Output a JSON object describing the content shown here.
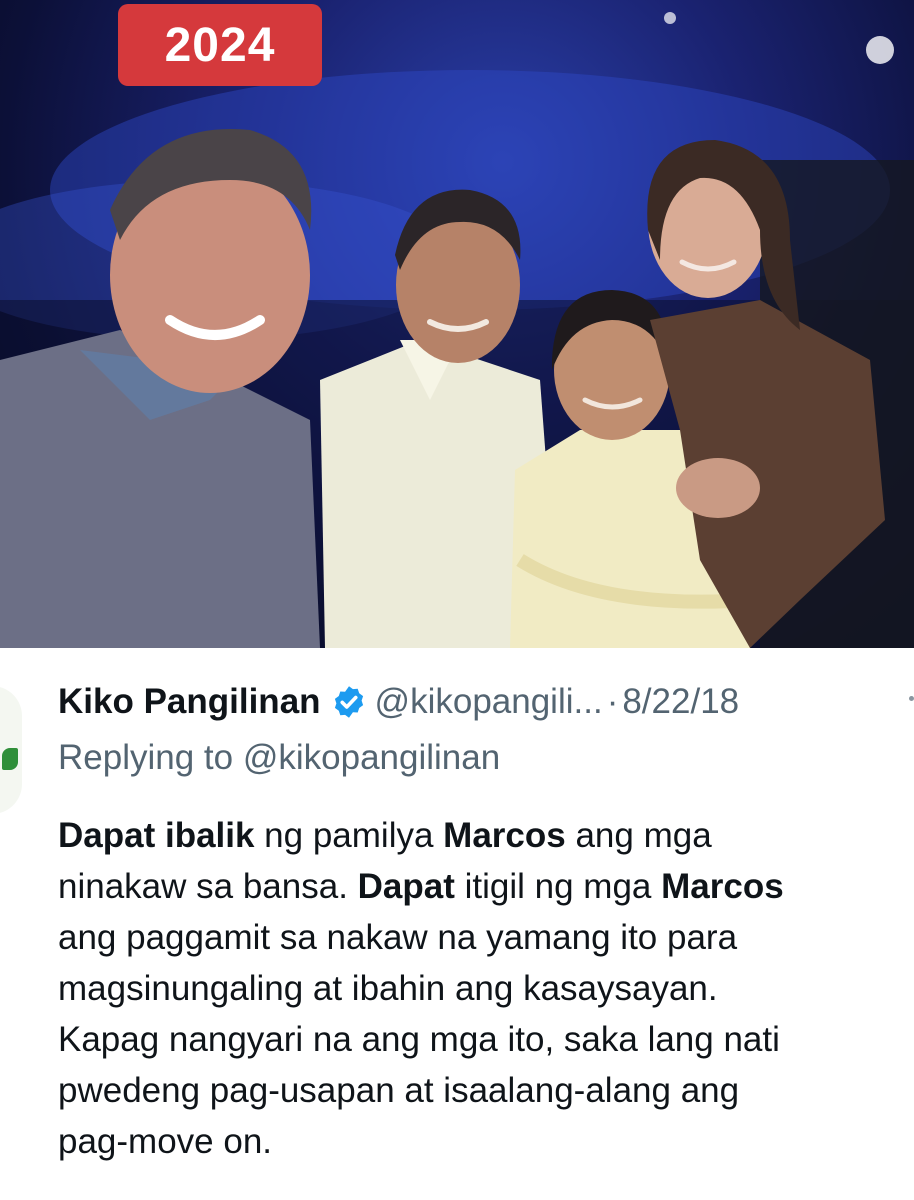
{
  "photo": {
    "year_badge": "2024",
    "accent": "#d5393c"
  },
  "tweet": {
    "author": {
      "display_name": "Kiko Pangilinan",
      "verified_icon": "verified-badge-icon",
      "handle": "@kikopangili...",
      "separator": "·",
      "date": "8/22/18"
    },
    "reply": {
      "prefix": "Replying to",
      "mention": "@kikopangilinan"
    },
    "body_lines": [
      [
        {
          "t": "Dapat ibalik",
          "b": true
        },
        {
          "t": " ng pamilya ",
          "b": false
        },
        {
          "t": "Marcos",
          "b": true
        },
        {
          "t": " ang mga",
          "b": false
        }
      ],
      [
        {
          "t": "ninakaw sa bansa. ",
          "b": false
        },
        {
          "t": "Dapat",
          "b": true
        },
        {
          "t": " itigil ng mga ",
          "b": false
        },
        {
          "t": "Marcos",
          "b": true
        }
      ],
      [
        {
          "t": "ang paggamit sa nakaw na yamang ito para",
          "b": false
        }
      ],
      [
        {
          "t": "magsinungaling at ibahin ang kasaysayan.",
          "b": false
        }
      ],
      [
        {
          "t": "Kapag nangyari na ang mga ito, saka lang nati",
          "b": false
        }
      ],
      [
        {
          "t": "pwedeng pag-usapan at isaalang-alang ang",
          "b": false
        }
      ],
      [
        {
          "t": "pag-move on.",
          "b": false
        }
      ]
    ],
    "colors": {
      "text": "#0f1419",
      "muted": "#536471",
      "verified": "#1d9bf0"
    }
  }
}
